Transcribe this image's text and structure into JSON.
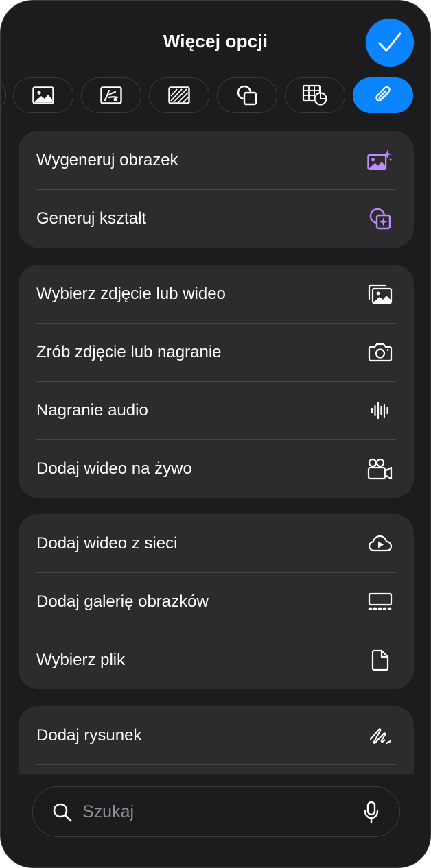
{
  "header": {
    "title": "Więcej opcji",
    "done_icon": "checkmark-icon"
  },
  "toolbar": {
    "tools": [
      {
        "name": "partial-tool-icon",
        "active": false
      },
      {
        "name": "image-icon",
        "active": false
      },
      {
        "name": "drawing-image-icon",
        "active": false
      },
      {
        "name": "texture-icon",
        "active": false
      },
      {
        "name": "shapes-icon",
        "active": false
      },
      {
        "name": "table-chart-icon",
        "active": false
      },
      {
        "name": "paperclip-icon",
        "active": true
      }
    ]
  },
  "groups": [
    {
      "items": [
        {
          "label": "Wygeneruj obrazek",
          "icon": "image-sparkles-icon"
        },
        {
          "label": "Generuj kształt",
          "icon": "shape-sparkle-icon"
        }
      ]
    },
    {
      "items": [
        {
          "label": "Wybierz zdjęcie lub wideo",
          "icon": "photo-stack-icon"
        },
        {
          "label": "Zrób zdjęcie lub nagranie",
          "icon": "camera-icon"
        },
        {
          "label": "Nagranie audio",
          "icon": "waveform-icon"
        },
        {
          "label": "Dodaj wideo na żywo",
          "icon": "video-camera-icon"
        }
      ]
    },
    {
      "items": [
        {
          "label": "Dodaj wideo z sieci",
          "icon": "cloud-play-icon"
        },
        {
          "label": "Dodaj galerię obrazków",
          "icon": "gallery-icon"
        },
        {
          "label": "Wybierz plik",
          "icon": "document-icon"
        }
      ]
    },
    {
      "items": [
        {
          "label": "Dodaj rysunek",
          "icon": "scribble-icon"
        }
      ]
    }
  ],
  "search": {
    "placeholder": "Szukaj",
    "search_icon": "magnifier-icon",
    "mic_icon": "microphone-icon"
  },
  "colors": {
    "accent": "#0a84ff",
    "ai_purple": "#bf8cff",
    "background": "#1c1c1e",
    "group_background": "#2c2c2e"
  }
}
